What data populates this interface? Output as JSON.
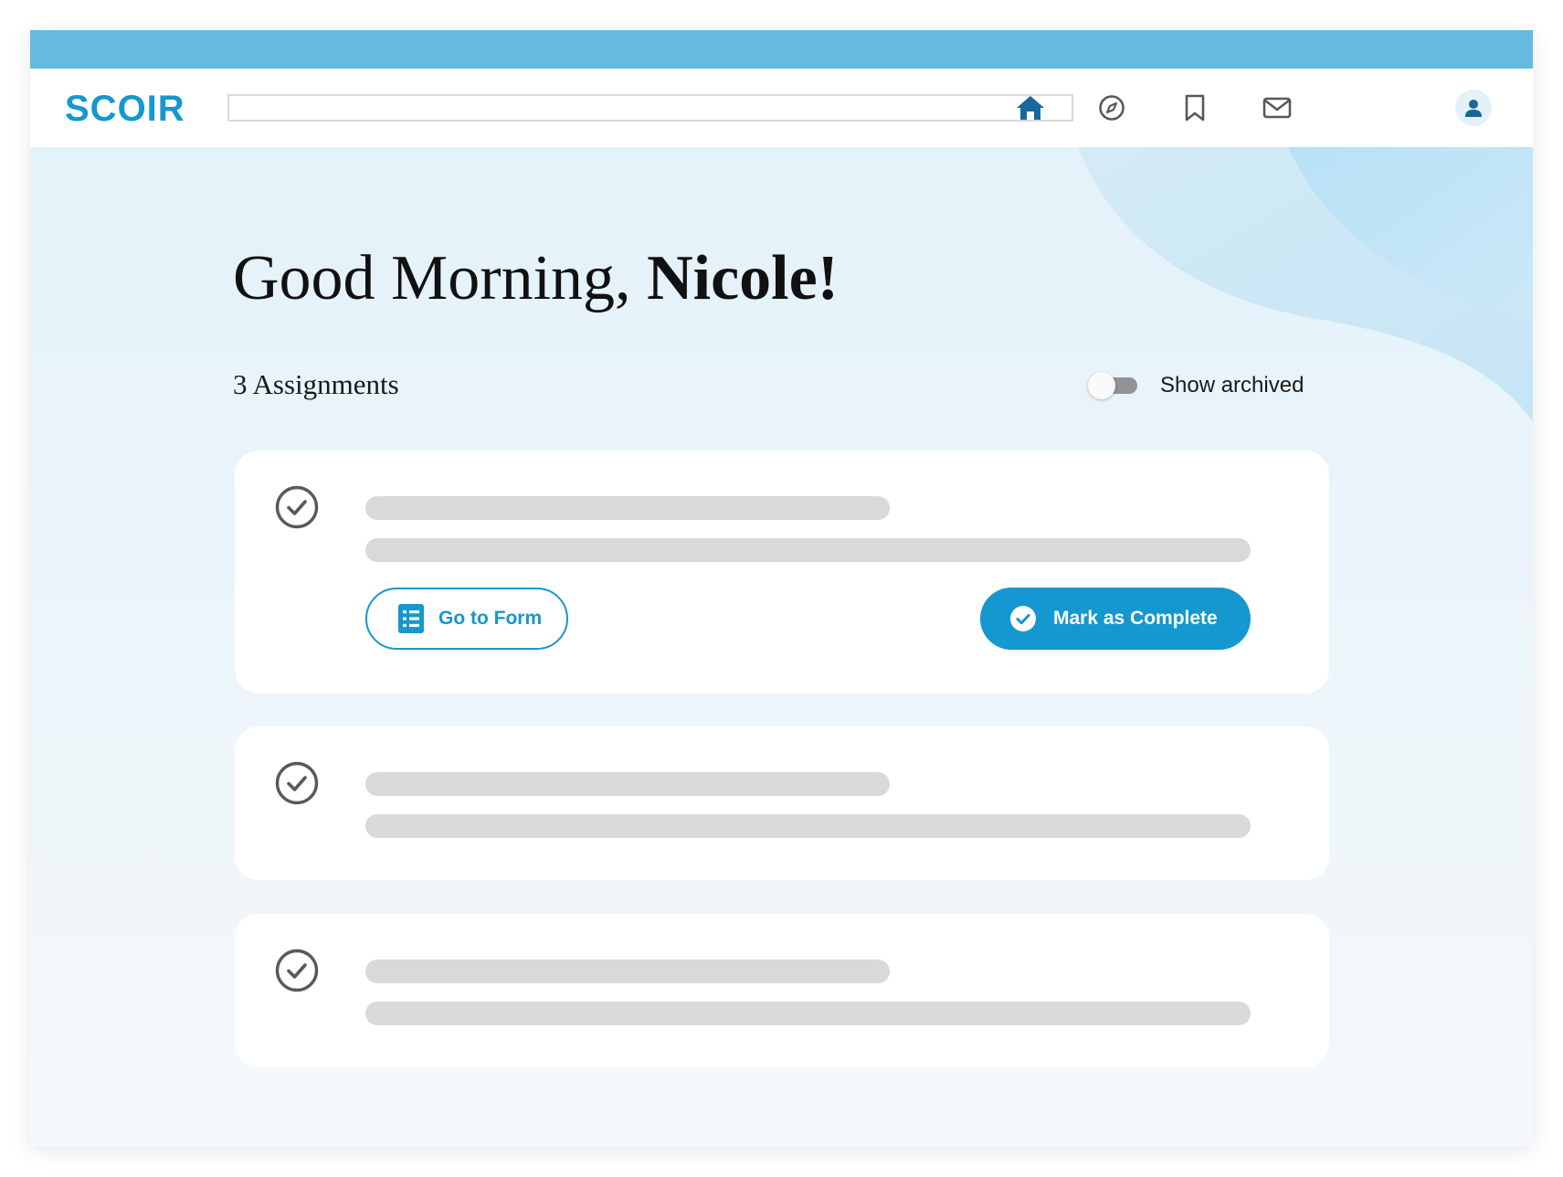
{
  "app": {
    "logo_text": "SCOIR",
    "brand_color": "#1597cf",
    "top_strip_color": "#66badf"
  },
  "navbar": {
    "search": {
      "value": "",
      "placeholder": ""
    },
    "icons": [
      "home-icon",
      "compass-icon",
      "bookmark-icon",
      "mail-icon",
      "user-icon"
    ],
    "active": "home"
  },
  "main": {
    "greeting_prefix": "Good Morning, ",
    "greeting_name": "Nicole!",
    "assignment_count_label": "3 Assignments",
    "show_archived_label": "Show archived",
    "show_archived_on": false
  },
  "assignments": [
    {
      "state": "loading",
      "go_to_form_label": "Go to Form",
      "mark_complete_label": "Mark as Complete"
    },
    {
      "state": "loading"
    },
    {
      "state": "loading"
    }
  ]
}
